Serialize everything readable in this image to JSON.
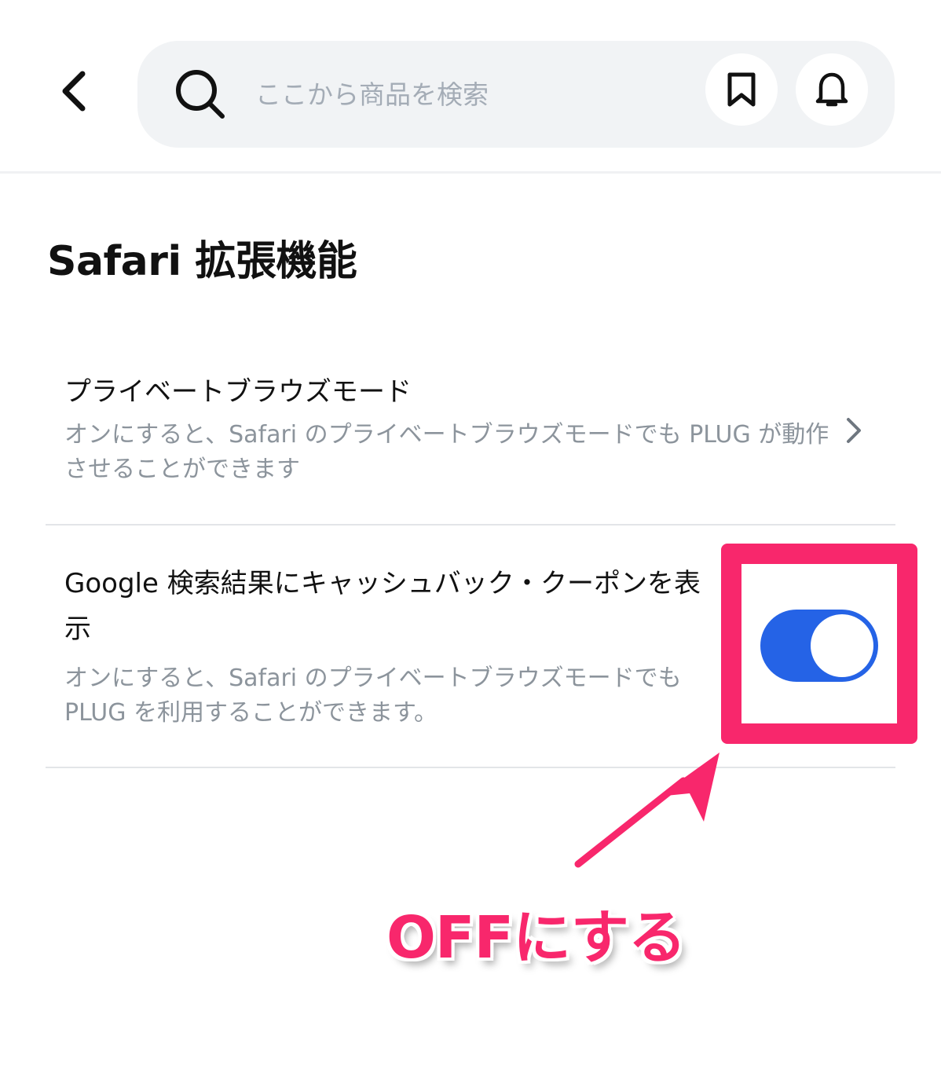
{
  "header": {
    "search": {
      "placeholder": "ここから商品を検索"
    },
    "icons": {
      "back": "chevron-left-icon",
      "search": "search-icon",
      "bookmark": "bookmark-icon",
      "bell": "bell-icon"
    }
  },
  "page": {
    "title": "Safari 拡張機能"
  },
  "settings": [
    {
      "title": "プライベートブラウズモード",
      "description": "オンにすると、Safari のプライベートブラウズモードでも PLUG が動作させることができます",
      "control": "chevron-right-icon"
    },
    {
      "title": "Google 検索結果にキャッシュバック・クーポンを表示",
      "description": "オンにすると、Safari のプライベートブラウズモードでもPLUG を利用することができます。",
      "control": "toggle",
      "toggle_on": true
    }
  ],
  "annotation": {
    "text": "OFFにする"
  },
  "colors": {
    "accent_pink": "#f8276c",
    "toggle_blue": "#2563e6",
    "search_bg": "#f1f3f5",
    "muted_text": "#8c949c"
  }
}
